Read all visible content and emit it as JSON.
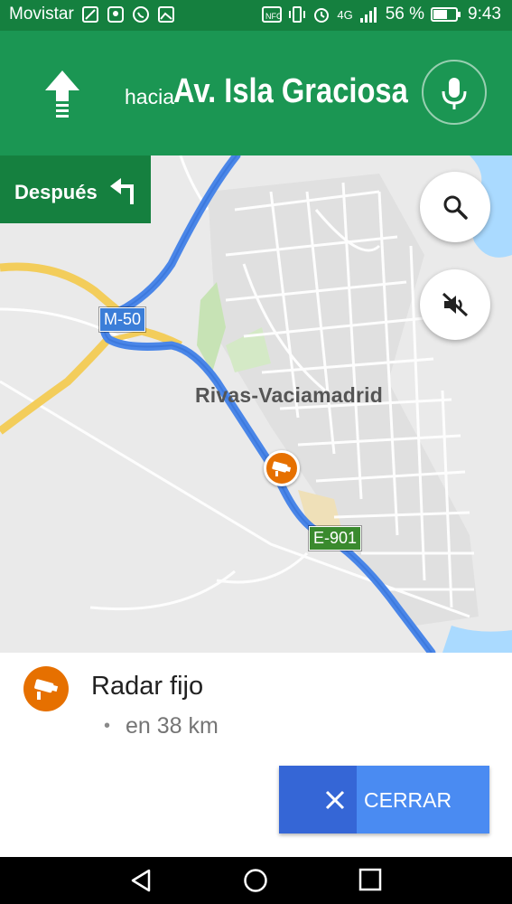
{
  "status_bar": {
    "carrier": "Movistar",
    "network": "4G",
    "battery": "56 %",
    "time": "9:43"
  },
  "navigation": {
    "maneuver_icon": "arrow-up-icon",
    "toward_label": "hacia",
    "street": "Av. Isla Graciosa",
    "mic_icon": "mic-icon"
  },
  "then_chip": {
    "label": "Después",
    "icon": "turn-left-icon"
  },
  "map": {
    "city": "Rivas-Vaciamadrid",
    "roads": [
      "M-50",
      "E-901"
    ],
    "search_icon": "search-icon",
    "mute_icon": "volume-off-icon"
  },
  "alert": {
    "icon": "speed-camera-icon",
    "title": "Radar fijo",
    "bullet": "•",
    "distance": "en 38 km",
    "close_label": "CERRAR",
    "auto_dismiss_progress": 0.37
  },
  "colors": {
    "nav_green": "#1b9653",
    "dark_green": "#15803f",
    "route_blue": "#4a86e8",
    "radar_orange": "#e67000",
    "button_blue": "#4a8bf2"
  }
}
